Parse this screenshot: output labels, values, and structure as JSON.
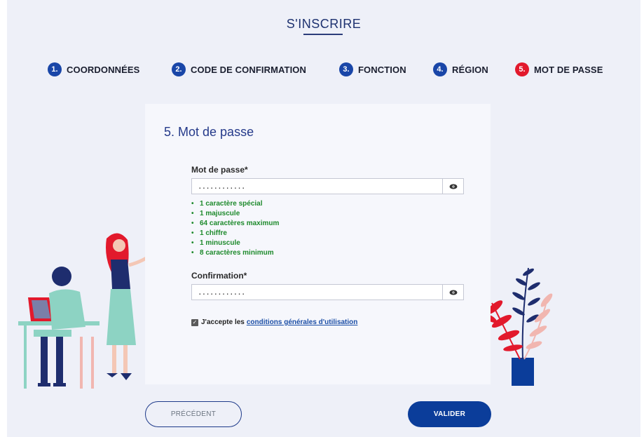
{
  "header": {
    "title": "S'INSCRIRE"
  },
  "steps": [
    {
      "number": "1.",
      "label": "COORDONNÉES",
      "active": false
    },
    {
      "number": "2.",
      "label": "CODE DE CONFIRMATION",
      "active": false
    },
    {
      "number": "3.",
      "label": "FONCTION",
      "active": false
    },
    {
      "number": "4.",
      "label": "RÉGION",
      "active": false
    },
    {
      "number": "5.",
      "label": "MOT DE PASSE",
      "active": true
    }
  ],
  "form": {
    "title": "5. Mot de passe",
    "password": {
      "label": "Mot de passe*",
      "value": "............"
    },
    "rules": [
      "1 caractère spécial",
      "1 majuscule",
      "64 caractères maximum",
      "1 chiffre",
      "1 minuscule",
      "8 caractères minimum"
    ],
    "confirmation": {
      "label": "Confirmation*",
      "value": "............"
    },
    "terms": {
      "checked": true,
      "prefix": "J'accepte les",
      "link": "conditions générales d'utilisation"
    }
  },
  "buttons": {
    "previous": "PRÉCÉDENT",
    "validate": "VALIDER"
  },
  "colors": {
    "step_active": "#e2192c",
    "step_inactive": "#1946a8",
    "primary": "#0b3d9a",
    "rule_ok": "#1e8a2c",
    "background": "#eef0f8"
  }
}
